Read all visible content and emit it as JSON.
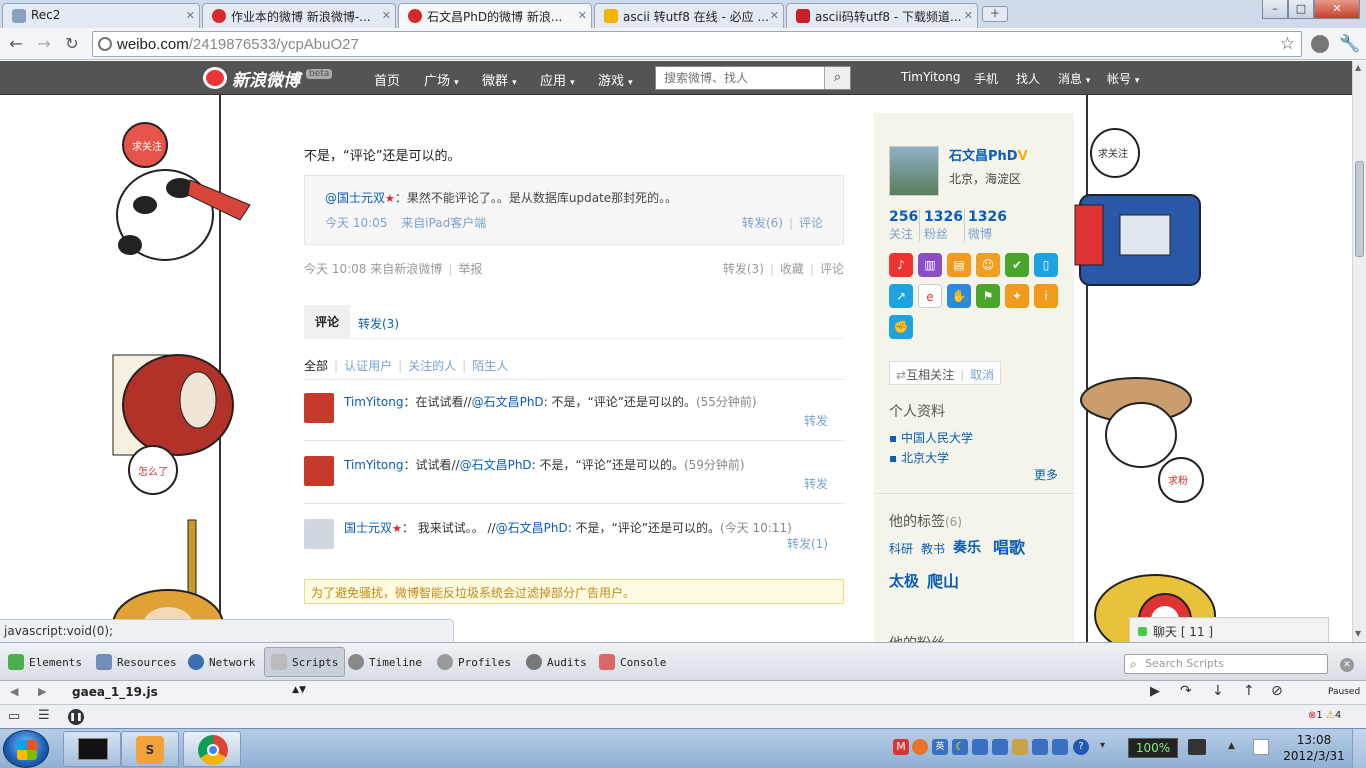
{
  "browser": {
    "tabs": [
      {
        "title": "Rec2",
        "color": "#8aa0c0"
      },
      {
        "title": "作业本的微博 新浪微博-...",
        "color": "#d52a2a"
      },
      {
        "title": "石文昌PhD的微博 新浪...",
        "color": "#d52a2a",
        "active": true
      },
      {
        "title": "ascii 转utf8 在线 - 必应 ...",
        "color": "#f5b400"
      },
      {
        "title": "ascii码转utf8 - 下载频道...",
        "color": "#c8202a"
      }
    ],
    "url_host": "weibo.com",
    "url_path": "/2419876533/ycpAbuO27"
  },
  "weibo_nav": {
    "logo": "新浪微博",
    "beta": "beta",
    "items": [
      "首页",
      "广场",
      "微群",
      "应用",
      "游戏"
    ],
    "search_placeholder": "搜索微博、找人",
    "user": "TimYitong",
    "right_items": [
      "手机",
      "找人",
      "消息",
      "帐号"
    ]
  },
  "post": {
    "text": "不是，“评论”还是可以的。",
    "quoted": {
      "author": "@国士元双",
      "text": "：果然不能评论了。。是从数据库update那封死的。。",
      "time": "今天 10:05",
      "source": "来自iPad客户端",
      "repost": "转发(6)",
      "comment": "评论"
    },
    "time": "今天 10:08 来自",
    "source": "新浪微博",
    "report": "举报",
    "repost": "转发(3)",
    "favorite": "收藏",
    "comment": "评论"
  },
  "tabs": {
    "comments": "评论",
    "reposts": "转发(3)"
  },
  "filters": [
    "全部",
    "认证用户",
    "关注的人",
    "陌生人"
  ],
  "comments": [
    {
      "user": "TimYitong",
      "pre": "：在试试看//",
      "mention": "@石文昌PhD",
      "text": ": 不是，“评论”还是可以的。",
      "time": "(55分钟前)",
      "action": "转发"
    },
    {
      "user": "TimYitong",
      "pre": "：试试看//",
      "mention": "@石文昌PhD",
      "text": ": 不是，“评论”还是可以的。",
      "time": "(59分钟前)",
      "action": "转发"
    },
    {
      "user": "国士元双",
      "pre": "： 我来试试。。 //",
      "mention": "@石文昌PhD",
      "text": ": 不是，“评论”还是可以的。",
      "time": "(今天 10:11)",
      "action": "转发(1)"
    }
  ],
  "notice": "为了避免骚扰，微博智能反垃圾系统会过滤掉部分广告用户。",
  "profile": {
    "name": "石文昌PhD",
    "location": "北京，海淀区",
    "stats": [
      {
        "num": "256",
        "label": "关注"
      },
      {
        "num": "1326",
        "label": "粉丝"
      },
      {
        "num": "1326",
        "label": "微博"
      }
    ],
    "mutual": "互相关注",
    "cancel": "取消",
    "info_title": "个人资料",
    "schools": [
      "中国人民大学",
      "北京大学"
    ],
    "more": "更多",
    "tags_title": "他的标签",
    "tags_count": "(6)",
    "tags": [
      "科研",
      "教书",
      "奏乐",
      "唱歌",
      "太极",
      "爬山"
    ],
    "next_title": "他的粉丝"
  },
  "chat": "聊天 [ 11 ]",
  "status_bar": "javascript:void(0);",
  "devtools": {
    "panels": [
      "Elements",
      "Resources",
      "Network",
      "Scripts",
      "Timeline",
      "Profiles",
      "Audits",
      "Console"
    ],
    "search_placeholder": "Search Scripts",
    "file": "gaea_1_19.js",
    "paused": "Paused",
    "errors": "1",
    "warnings": "4"
  },
  "taskbar": {
    "battery": "100%",
    "time": "13:08",
    "date": "2012/3/31"
  },
  "doodle_texts": [
    "求关注",
    "求粉",
    "怎么了"
  ]
}
